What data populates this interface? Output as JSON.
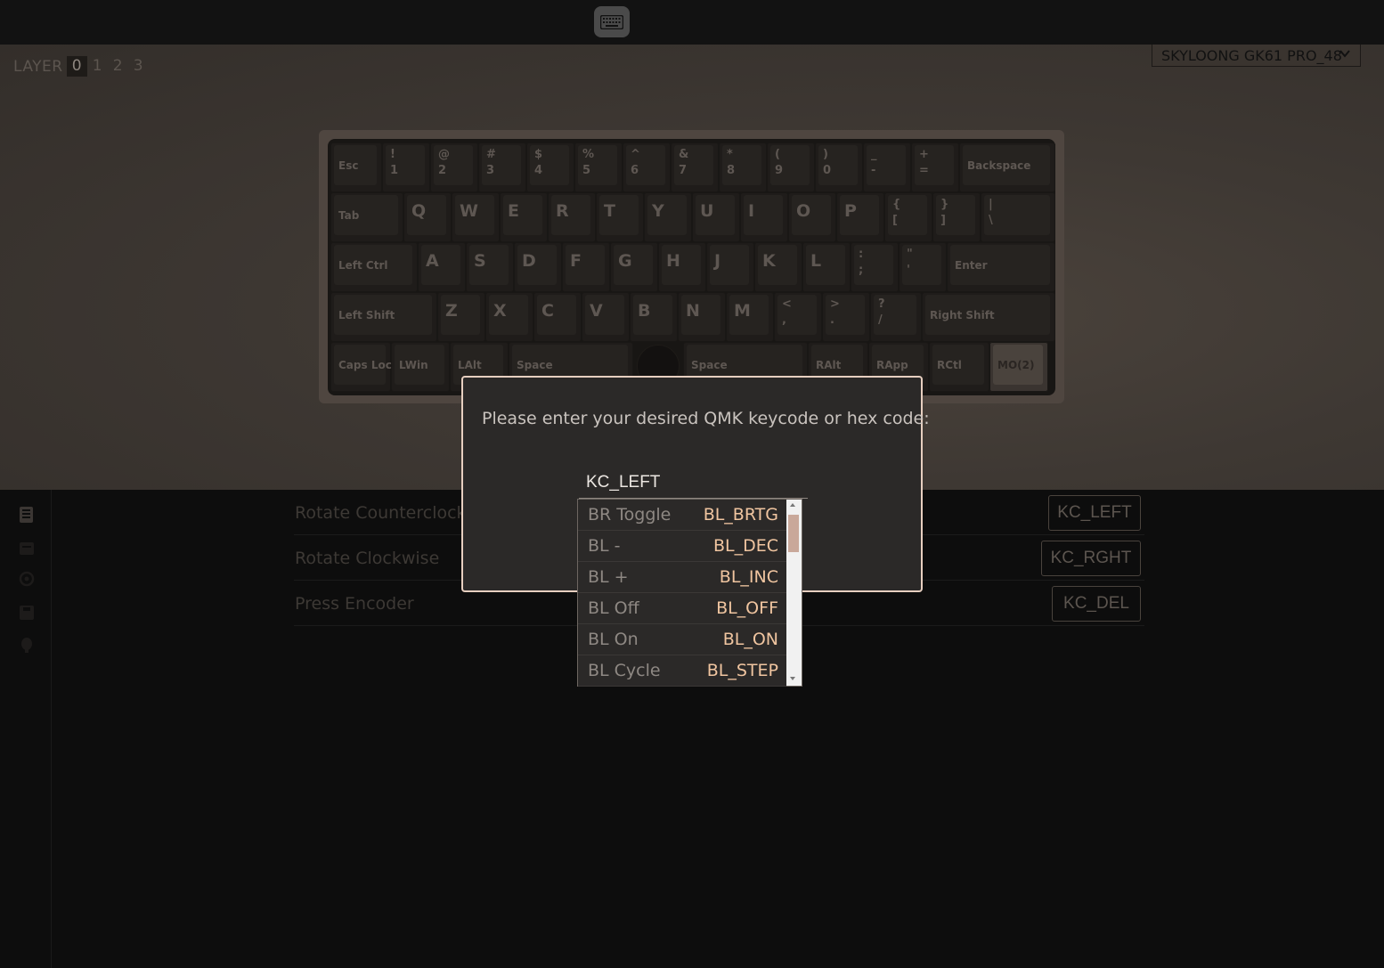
{
  "layers": {
    "title": "LAYER",
    "items": [
      "0",
      "1",
      "2",
      "3"
    ],
    "active": "0"
  },
  "device": {
    "selected": "SKYLOONG GK61 PRO_48"
  },
  "keyboard": {
    "row1": [
      {
        "single": "Esc"
      },
      {
        "top": "!",
        "bot": "1"
      },
      {
        "top": "@",
        "bot": "2"
      },
      {
        "top": "#",
        "bot": "3"
      },
      {
        "top": "$",
        "bot": "4"
      },
      {
        "top": "%",
        "bot": "5"
      },
      {
        "top": "^",
        "bot": "6"
      },
      {
        "top": "&",
        "bot": "7"
      },
      {
        "top": "*",
        "bot": "8"
      },
      {
        "top": "(",
        "bot": "9"
      },
      {
        "top": ")",
        "bot": "0"
      },
      {
        "top": "_",
        "bot": "-"
      },
      {
        "top": "+",
        "bot": "="
      },
      {
        "single": "Backspace"
      }
    ],
    "row2": [
      {
        "single": "Tab"
      },
      {
        "big": "Q"
      },
      {
        "big": "W"
      },
      {
        "big": "E"
      },
      {
        "big": "R"
      },
      {
        "big": "T"
      },
      {
        "big": "Y"
      },
      {
        "big": "U"
      },
      {
        "big": "I"
      },
      {
        "big": "O"
      },
      {
        "big": "P"
      },
      {
        "top": "{",
        "bot": "["
      },
      {
        "top": "}",
        "bot": "]"
      },
      {
        "top": "|",
        "bot": "\\"
      }
    ],
    "row3": [
      {
        "single": "Left Ctrl"
      },
      {
        "big": "A"
      },
      {
        "big": "S"
      },
      {
        "big": "D"
      },
      {
        "big": "F"
      },
      {
        "big": "G"
      },
      {
        "big": "H"
      },
      {
        "big": "J"
      },
      {
        "big": "K"
      },
      {
        "big": "L"
      },
      {
        "top": ":",
        "bot": ";"
      },
      {
        "top": "\"",
        "bot": "'"
      },
      {
        "single": "Enter"
      }
    ],
    "row4": [
      {
        "single": "Left Shift"
      },
      {
        "big": "Z"
      },
      {
        "big": "X"
      },
      {
        "big": "C"
      },
      {
        "big": "V"
      },
      {
        "big": "B"
      },
      {
        "big": "N"
      },
      {
        "big": "M"
      },
      {
        "top": "<",
        "bot": ","
      },
      {
        "top": ">",
        "bot": "."
      },
      {
        "top": "?",
        "bot": "/"
      },
      {
        "single": "Right Shift"
      }
    ],
    "row5": [
      {
        "single": "Caps Loc"
      },
      {
        "single": "LWin"
      },
      {
        "single": "LAlt"
      },
      {
        "single": "Space"
      },
      {
        "single": "Space"
      },
      {
        "single": "RAlt"
      },
      {
        "single": "RApp"
      },
      {
        "single": "RCtl"
      },
      {
        "single": "MO(2)"
      }
    ]
  },
  "encoder": {
    "rows": [
      {
        "label": "Rotate Counterclockwise",
        "value": "KC_LEFT"
      },
      {
        "label": "Rotate Clockwise",
        "value": "KC_RGHT"
      },
      {
        "label": "Press Encoder",
        "value": "KC_DEL"
      }
    ]
  },
  "modal": {
    "prompt": "Please enter your desired QMK keycode or hex code:",
    "input_value": "KC_LEFT",
    "options": [
      {
        "name": "BR Toggle",
        "code": "BL_BRTG"
      },
      {
        "name": "BL -",
        "code": "BL_DEC"
      },
      {
        "name": "BL +",
        "code": "BL_INC"
      },
      {
        "name": "BL Off",
        "code": "BL_OFF"
      },
      {
        "name": "BL On",
        "code": "BL_ON"
      },
      {
        "name": "BL Cycle",
        "code": "BL_STEP"
      }
    ]
  },
  "sidebar": {
    "icons": [
      "keymap-icon",
      "macros-icon",
      "lighting-icon",
      "save-icon",
      "debug-icon"
    ]
  },
  "colors": {
    "accent": "#e7cfc0",
    "code_text": "#f0c5a0"
  }
}
